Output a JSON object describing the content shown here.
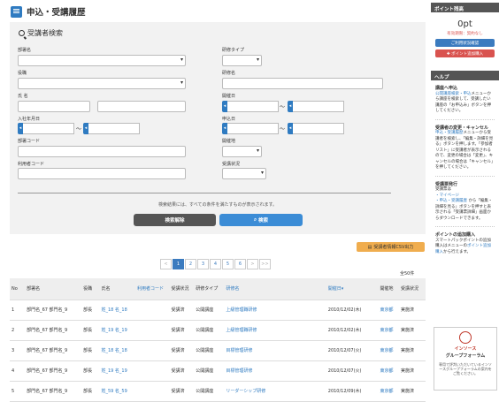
{
  "page_title": "申込・受講履歴",
  "search": {
    "heading": "受講者検索",
    "labels": {
      "dept": "部署名",
      "training_type": "研修タイプ",
      "position": "役職",
      "training_name": "研修名",
      "name": "氏 名",
      "open_date": "開催日",
      "join_date": "入社年月日",
      "apply_date": "申込日",
      "dept_code": "部署コード",
      "venue": "開催地",
      "user_code": "利用者コード",
      "status": "受講状況"
    },
    "tilde": "〜",
    "note": "検索結果には、すべての条件を満たすものが表示されます。",
    "clear_label": "検索解除",
    "search_label": "検索"
  },
  "csv_label": "受講者情報CSV出力",
  "pagination": [
    "<",
    "1",
    "2",
    "3",
    "4",
    "5",
    "6",
    ">",
    ">>"
  ],
  "pagination_active": "1",
  "count": "全50件",
  "table": {
    "headers": [
      "No",
      "部署名",
      "役職",
      "氏名",
      "利用者コード",
      "受講状況",
      "研修タイプ",
      "研修名",
      "開催日▾",
      "開催地",
      "受講状況"
    ],
    "rows": [
      {
        "no": "1",
        "dept": "部門名_67 部門名_9",
        "pos": "部長",
        "name": "姓_18 名_18",
        "code": "",
        "status": "受講済",
        "type": "公開講座",
        "training": "上級管理職研修",
        "date": "2010/12/02(木)",
        "venue": "東京都",
        "state": "実施済"
      },
      {
        "no": "2",
        "dept": "部門名_67 部門名_9",
        "pos": "部長",
        "name": "姓_19 名_19",
        "code": "",
        "status": "受講済",
        "type": "公開講座",
        "training": "上級管理職研修",
        "date": "2010/12/02(木)",
        "venue": "東京都",
        "state": "実施済"
      },
      {
        "no": "3",
        "dept": "部門名_67 部門名_9",
        "pos": "部長",
        "name": "姓_18 名_18",
        "code": "",
        "status": "受講済",
        "type": "公開講座",
        "training": "目標管理研修",
        "date": "2010/12/07(火)",
        "venue": "東京都",
        "state": "実施済"
      },
      {
        "no": "4",
        "dept": "部門名_67 部門名_9",
        "pos": "部長",
        "name": "姓_19 名_19",
        "code": "",
        "status": "受講済",
        "type": "公開講座",
        "training": "目標管理研修",
        "date": "2010/12/07(火)",
        "venue": "東京都",
        "state": "実施済"
      },
      {
        "no": "5",
        "dept": "部門名_67 部門名_9",
        "pos": "部長",
        "name": "姓_59 名_59",
        "code": "",
        "status": "受講済",
        "type": "公開講座",
        "training": "リーダーシップ研修",
        "date": "2010/12/09(木)",
        "venue": "東京都",
        "state": "実施済"
      }
    ]
  },
  "sidebar": {
    "points_head": "ポイント残高",
    "points": "0pt",
    "points_sub": "有効期限：契約なし",
    "history_btn": "ご利用状況確認",
    "buy_btn": "✚ ポイント追加購入",
    "help_head": "ヘルプ",
    "help1_title": "講座へ申込",
    "help1_link": "公開講座検索・申込",
    "help1_text": "メニューから講座を検索して、受講したい講座の「お申込み」ボタンを押してください。",
    "help2_title": "受講者の変更・キャンセル",
    "help2_link": "申込・受講履歴",
    "help2_text": "メニューから受講者を検索し、「編集・詳細を見る」ボタンを押します。「参加者リスト」に受講者が表示されるので、変更の場合は「変更」、キャンセルの場合は「キャンセル」を押してください。",
    "help3_title": "受講票発行",
    "help3_sub": "受講票は",
    "help3_link1": "・マイページ",
    "help3_link2": "・申込・受講履歴",
    "help3_text": "から「編集・詳細を見る」ボタンを押すと表示される「受講票詳細」画面からダウンロードできます。",
    "help4_title": "ポイントの追加購入",
    "help4_text": "スマートパックポイントの追加購入はメニューの",
    "help4_link": "ポイント追加購入",
    "help4_text2": "から行えます。",
    "logo_t1": "インソース",
    "logo_t2": "グループフォーラム",
    "logo_t3": "専用で評判いただいているインソースグループフォーラムの案内をご覧ください。"
  }
}
